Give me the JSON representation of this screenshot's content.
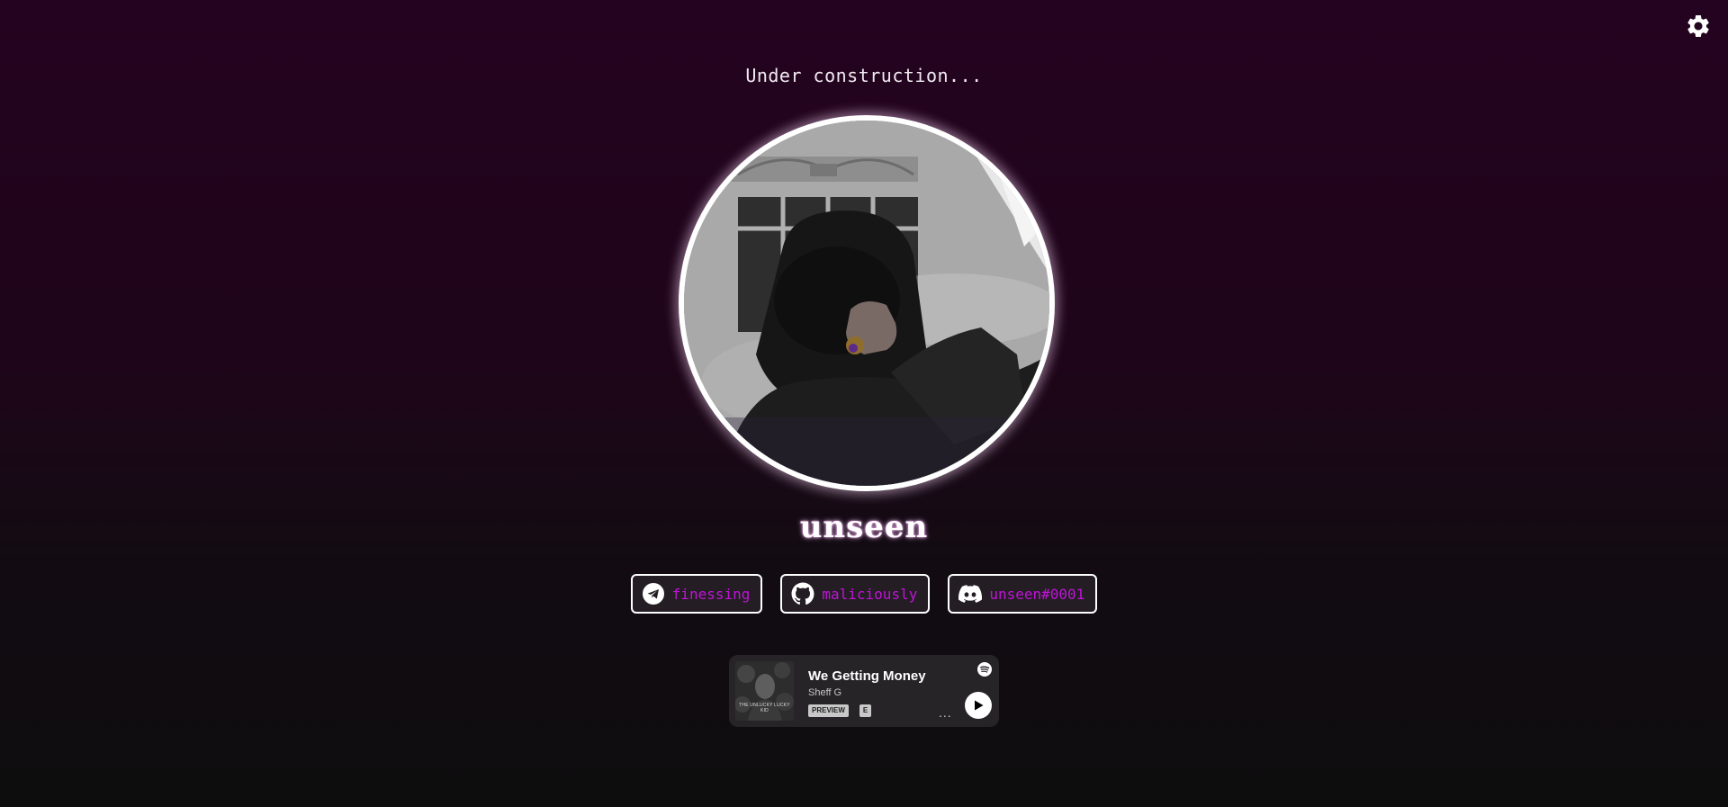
{
  "header": {
    "status_text": "Under construction...",
    "settings_icon": "gear-icon"
  },
  "profile": {
    "username": "unseen",
    "accent_color": "#c013d8"
  },
  "socials": [
    {
      "icon": "telegram-icon",
      "label": "finessing"
    },
    {
      "icon": "github-icon",
      "label": "maliciously"
    },
    {
      "icon": "discord-icon",
      "label": "unseen#0001"
    }
  ],
  "spotify": {
    "track_title": "We Getting Money",
    "artist": "Sheff G",
    "preview_label": "PREVIEW",
    "explicit_label": "E",
    "more_label": "...",
    "album_text": "THE UNLUCKY LUCKY KID",
    "icons": [
      "spotify-icon",
      "more-icon",
      "play-icon"
    ]
  }
}
